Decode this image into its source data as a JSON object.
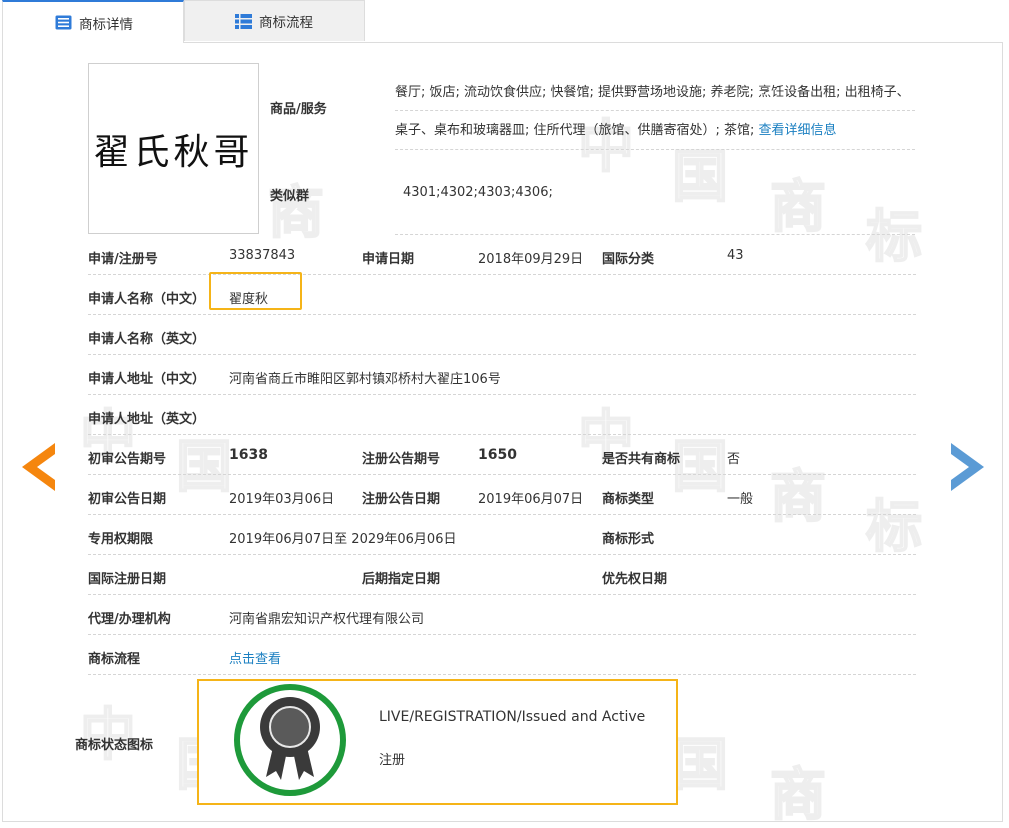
{
  "tabs": [
    {
      "label": "商标详情",
      "icon": "document-list-icon",
      "active": true
    },
    {
      "label": "商标流程",
      "icon": "grid-list-icon",
      "active": false
    }
  ],
  "watermark": {
    "chars": [
      "中",
      "国",
      "商",
      "标"
    ]
  },
  "logo": {
    "text": "翟氏秋哥"
  },
  "goods": {
    "label": "商品/服务",
    "text": "餐厅; 饭店; 流动饮食供应; 快餐馆; 提供野营场地设施; 养老院; 烹饪设备出租; 出租椅子、桌子、桌布和玻璃器皿; 住所代理（旅馆、供膳寄宿处）; 茶馆; ",
    "link": "查看详细信息"
  },
  "similar_group": {
    "label": "类似群",
    "value": "4301;4302;4303;4306;"
  },
  "fields": {
    "reg_no_label": "申请/注册号",
    "reg_no": "33837843",
    "app_date_label": "申请日期",
    "app_date": "2018年09月29日",
    "intl_class_label": "国际分类",
    "intl_class": "43",
    "applicant_cn_label": "申请人名称（中文）",
    "applicant_cn": "翟度秋",
    "applicant_en_label": "申请人名称（英文）",
    "address_cn_label": "申请人地址（中文）",
    "address_cn": "河南省商丘市睢阳区郭村镇邓桥村大翟庄106号",
    "address_en_label": "申请人地址（英文）",
    "prelim_no_label": "初审公告期号",
    "prelim_no": "1638",
    "reg_pub_no_label": "注册公告期号",
    "reg_pub_no": "1650",
    "shared_label": "是否共有商标",
    "shared": "否",
    "prelim_date_label": "初审公告日期",
    "prelim_date": "2019年03月06日",
    "reg_pub_date_label": "注册公告日期",
    "reg_pub_date": "2019年06月07日",
    "tm_type_label": "商标类型",
    "tm_type": "一般",
    "term_label": "专用权期限",
    "term": "2019年06月07日至 2029年06月06日",
    "tm_form_label": "商标形式",
    "intl_reg_date_label": "国际注册日期",
    "later_date_label": "后期指定日期",
    "priority_date_label": "优先权日期",
    "agent_label": "代理/办理机构",
    "agent": "河南省鼎宏知识产权代理有限公司",
    "flow_label": "商标流程",
    "flow_link": "点击查看",
    "status_icon_label": "商标状态图标"
  },
  "status": {
    "en": "LIVE/REGISTRATION/Issued and Active",
    "cn": "注册",
    "icon": "award-ribbon-icon"
  },
  "nav": {
    "prev": "left-arrow-icon",
    "next": "right-arrow-icon"
  },
  "colors": {
    "highlight": "#f5b418",
    "link": "#1a7fc1",
    "status_ring": "#1e9a3a",
    "prev_arrow": "#f5860e",
    "next_arrow": "#5b9bd5"
  }
}
